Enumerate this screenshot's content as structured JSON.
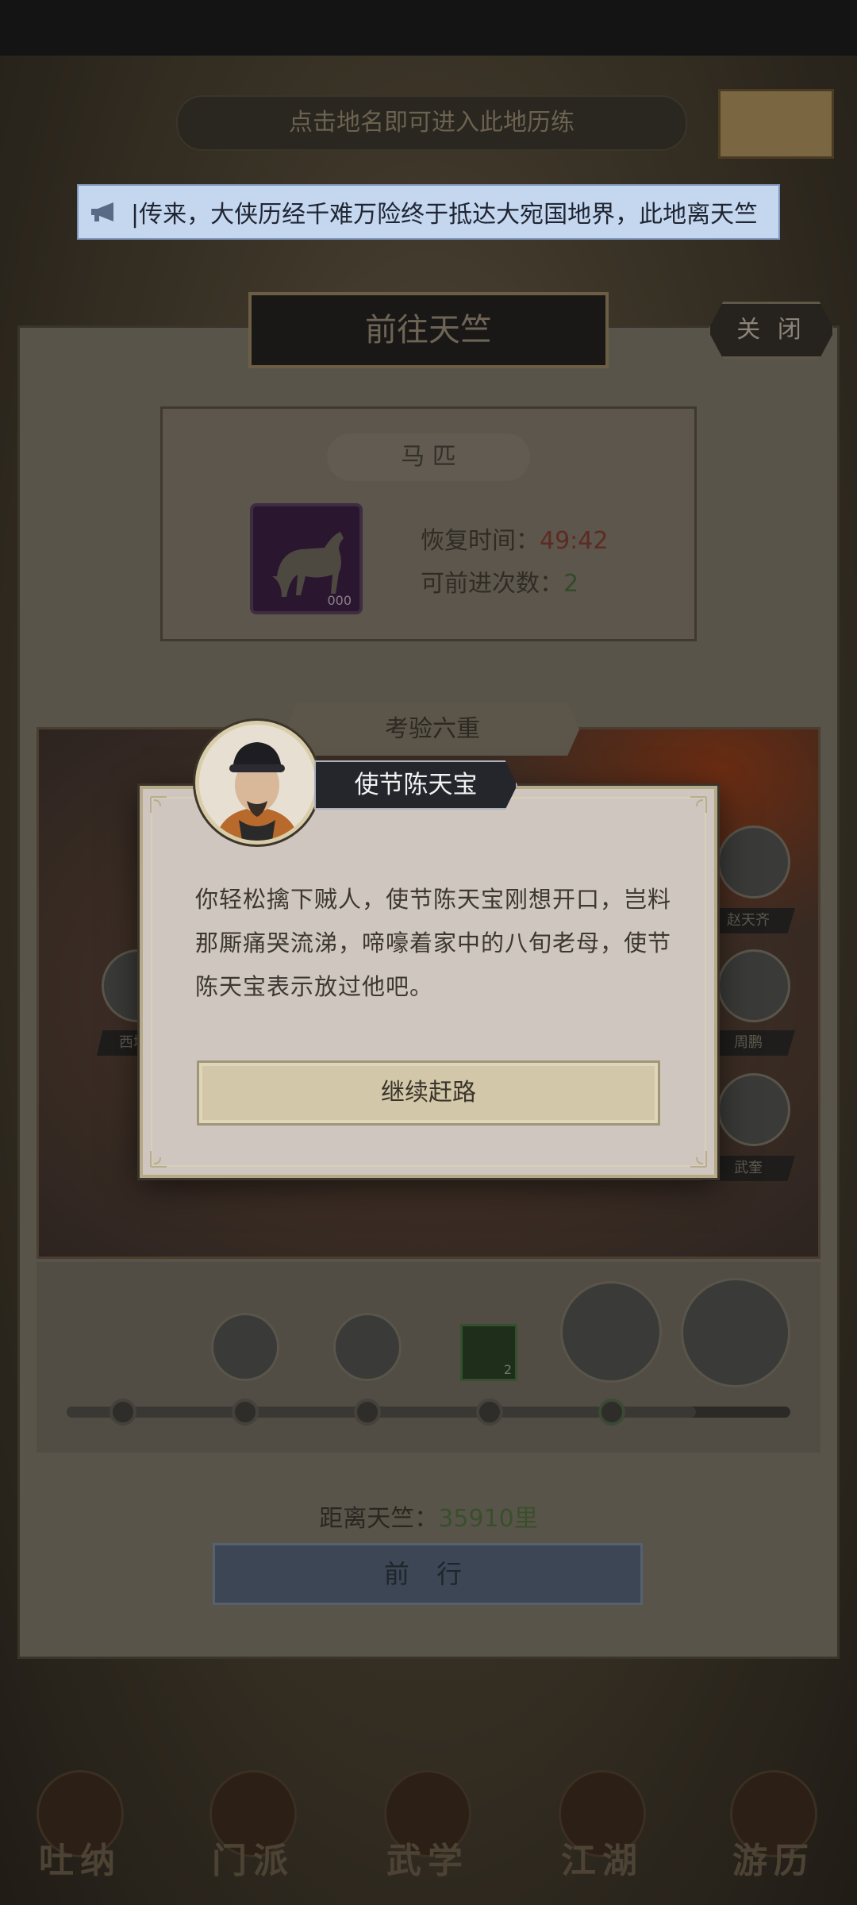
{
  "top_hint": "点击地名即可进入此地历练",
  "notice": {
    "text": "|传来，大侠历经千难万险终于抵达大宛国地界，此地离天竺"
  },
  "panel": {
    "title": "前往天竺",
    "close_label": "关 闭"
  },
  "horse": {
    "title": "马 匹",
    "icon_count": "000",
    "recover_label": "恢复时间：",
    "recover_value": "49:42",
    "advance_label": "可前进次数：",
    "advance_value": "2"
  },
  "trial": {
    "title": "考验六重"
  },
  "scene_characters": [
    {
      "name": "赵天齐"
    },
    {
      "name": "周鹏"
    },
    {
      "name": "武奎"
    },
    {
      "name": "西域"
    }
  ],
  "progress": {
    "item_count": "2",
    "fraction": 0.87
  },
  "distance": {
    "label": "距离天竺：",
    "value": "35910里"
  },
  "forward_label": "前 行",
  "bottom_nav": [
    {
      "label": "吐纳"
    },
    {
      "label": "门派"
    },
    {
      "label": "武学"
    },
    {
      "label": "江湖"
    },
    {
      "label": "游历"
    }
  ],
  "dialog": {
    "speaker": "使节陈天宝",
    "text": "你轻松擒下贼人，使节陈天宝刚想开口，岂料那厮痛哭流涕，啼嚎着家中的八旬老母，使节陈天宝表示放过他吧。",
    "continue_label": "继续赶路"
  },
  "colors": {
    "dialog_bg": "#cfc7bf",
    "notice_bg": "#c5d7ef",
    "value_red": "#a0362a",
    "value_green": "#4f7a37"
  }
}
